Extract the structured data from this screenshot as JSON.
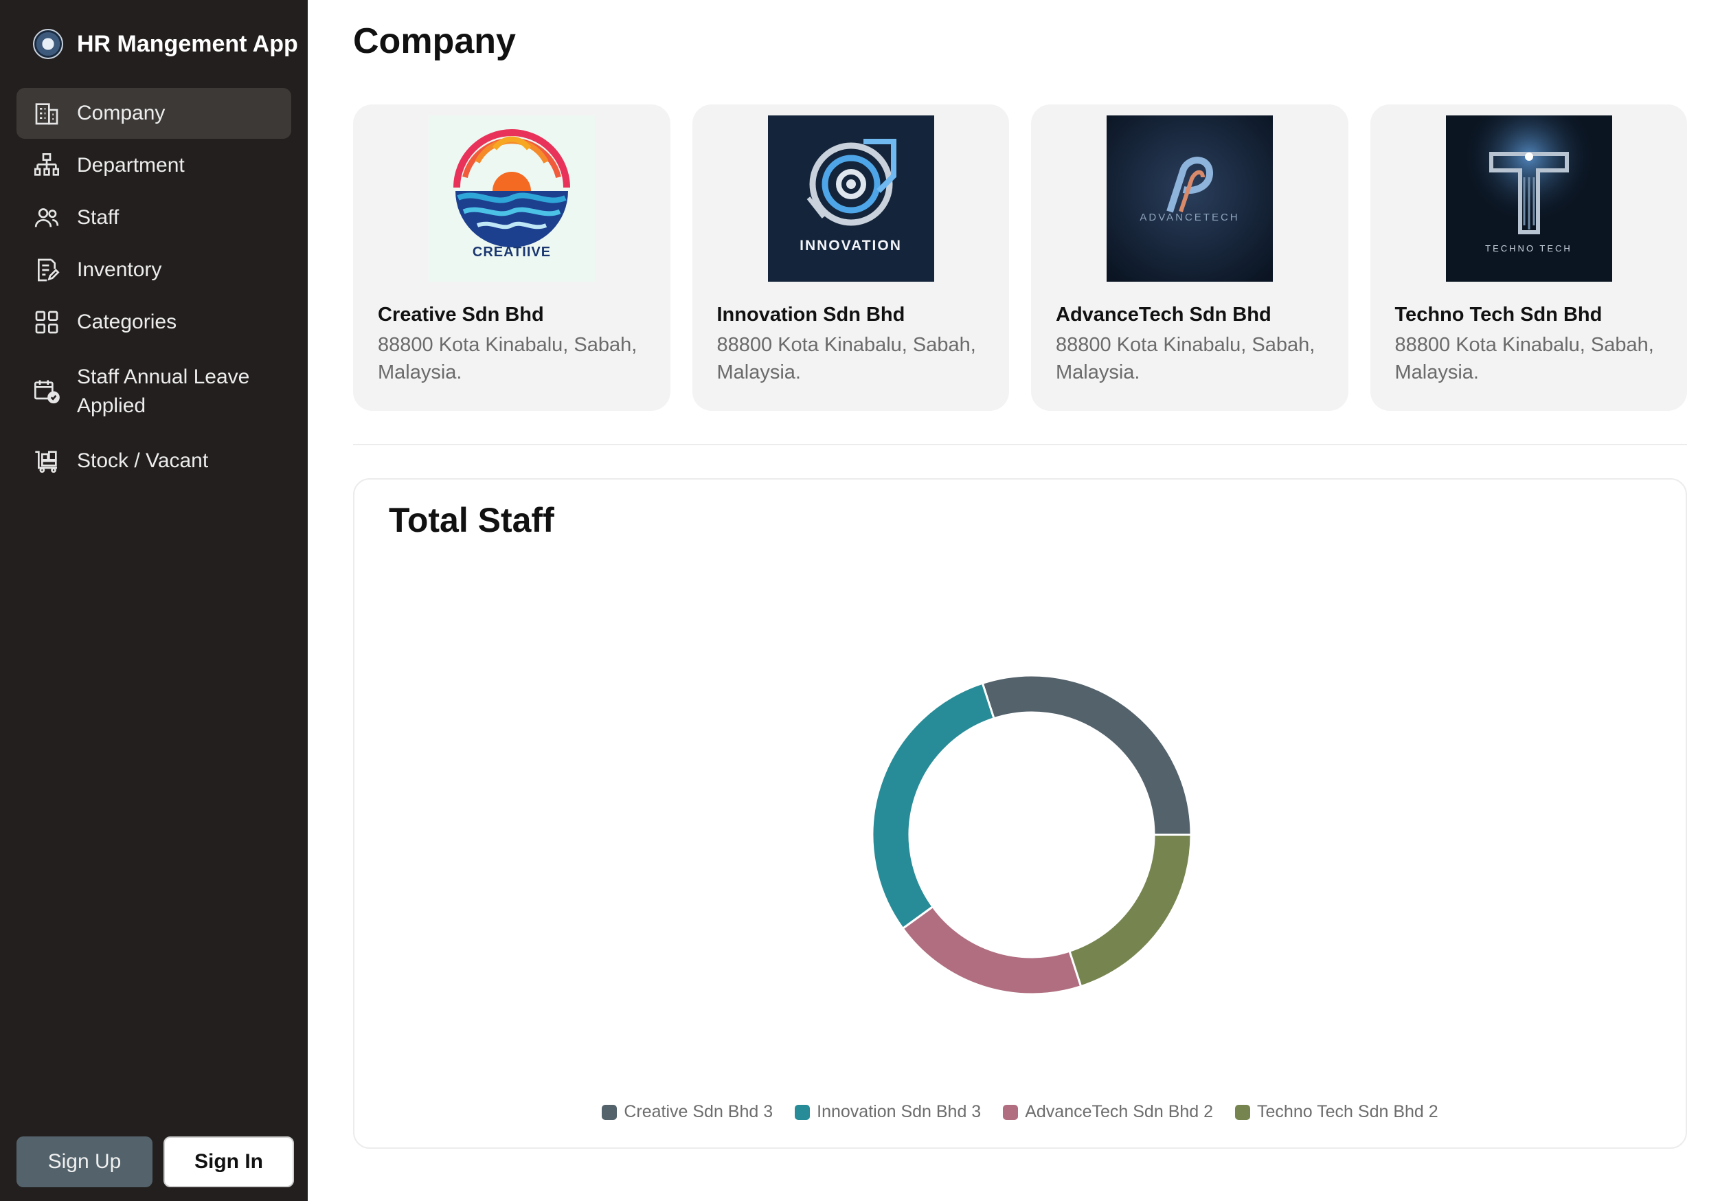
{
  "app": {
    "title": "HR Mangement App"
  },
  "nav": {
    "items": [
      {
        "label": "Company",
        "icon": "building-icon",
        "active": true
      },
      {
        "label": "Department",
        "icon": "hierarchy-icon"
      },
      {
        "label": "Staff",
        "icon": "users-icon"
      },
      {
        "label": "Inventory",
        "icon": "clipboard-edit-icon"
      },
      {
        "label": "Categories",
        "icon": "grid-icon"
      },
      {
        "label": "Staff Annual Leave Applied",
        "icon": "calendar-check-icon"
      },
      {
        "label": "Stock / Vacant",
        "icon": "cart-icon"
      }
    ]
  },
  "auth": {
    "signup": "Sign Up",
    "signin": "Sign In"
  },
  "page": {
    "title": "Company"
  },
  "companies": [
    {
      "name": "Creative Sdn Bhd",
      "address": "88800 Kota Kinabalu, Sabah, Malaysia.",
      "logo_text": "CREATIIVE"
    },
    {
      "name": "Innovation Sdn Bhd",
      "address": "88800 Kota Kinabalu, Sabah, Malaysia.",
      "logo_text": "INNOVATION"
    },
    {
      "name": "AdvanceTech Sdn Bhd",
      "address": "88800 Kota Kinabalu, Sabah, Malaysia.",
      "logo_text": "ADVANCETECH"
    },
    {
      "name": "Techno Tech Sdn Bhd",
      "address": "88800 Kota Kinabalu, Sabah, Malaysia.",
      "logo_text": "TECHNO TECH"
    }
  ],
  "staff_panel": {
    "title": "Total Staff"
  },
  "chart_data": {
    "type": "pie",
    "title": "Total Staff",
    "categories": [
      "Creative Sdn Bhd",
      "Innovation Sdn Bhd",
      "AdvanceTech Sdn Bhd",
      "Techno Tech Sdn Bhd"
    ],
    "values": [
      3,
      3,
      2,
      2
    ],
    "colors": [
      "#53626b",
      "#278c97",
      "#b06e80",
      "#76854f"
    ],
    "legend": "bottom"
  }
}
